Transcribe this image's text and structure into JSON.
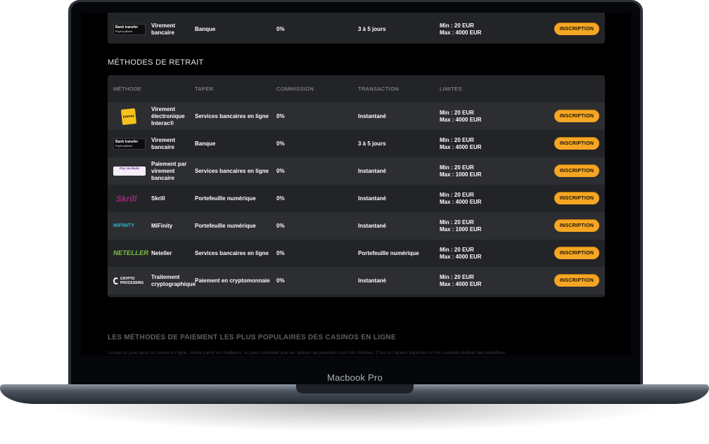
{
  "device": {
    "label": "Macbook Pro"
  },
  "top_row": {
    "logo_text": "Bank transfer",
    "logo_sub": "PayKeyBank",
    "name": "Virement bancaire",
    "type": "Banque",
    "commission": "0%",
    "transaction": "3 à 5 jours",
    "limit_min": "Min : 20 EUR",
    "limit_max": "Max : 4000 EUR",
    "button": "INSCRIPTION"
  },
  "withdrawal": {
    "title": "MÉTHODES DE RETRAIT",
    "headers": {
      "method": "MÉTHODE",
      "type": "TAPER",
      "commission": "COMMISSION",
      "transaction": "TRANSACTION",
      "limits": "LIMITES"
    },
    "rows": [
      {
        "logo": "interac-logo",
        "logo_text": "Interac",
        "name": "Virement électronique Interac®",
        "type": "Services bancaires en ligne",
        "commission": "0%",
        "transaction": "Instantané",
        "limit_min": "Min : 20 EUR",
        "limit_max": "Max : 4000 EUR",
        "button": "INSCRIPTION"
      },
      {
        "logo": "bank-transfer-logo",
        "logo_text": "Bank transfer",
        "logo_sub": "PayKeyBank",
        "name": "Virement bancaire",
        "type": "Banque",
        "commission": "0%",
        "transaction": "3 à 5 jours",
        "limit_min": "Min : 20 EUR",
        "limit_max": "Max : 4000 EUR",
        "button": "INSCRIPTION"
      },
      {
        "logo": "paybybank-logo",
        "logo_text": "Pay via Bank",
        "name": "Paiement par virement bancaire",
        "type": "Services bancaires en ligne",
        "commission": "0%",
        "transaction": "Instantané",
        "limit_min": "Min : 20 EUR",
        "limit_max": "Max : 1000 EUR",
        "button": "INSCRIPTION"
      },
      {
        "logo": "skrill-logo",
        "logo_text": "Skrill",
        "name": "Skrill",
        "type": "Portefeuille numérique",
        "commission": "0%",
        "transaction": "Instantané",
        "limit_min": "Min : 20 EUR",
        "limit_max": "Max : 4000 EUR",
        "button": "INSCRIPTION"
      },
      {
        "logo": "mifinity-logo",
        "logo_text": "MiFINITY",
        "name": "MiFinity",
        "type": "Portefeuille numérique",
        "commission": "0%",
        "transaction": "Instantané",
        "limit_min": "Min : 20 EUR",
        "limit_max": "Max : 1000 EUR",
        "button": "INSCRIPTION"
      },
      {
        "logo": "neteller-logo",
        "logo_text": "NETELLER",
        "name": "Neteller",
        "type": "Services bancaires en ligne",
        "commission": "0%",
        "transaction": "Portefeuille numérique",
        "limit_min": "Min : 20 EUR",
        "limit_max": "Max : 4000 EUR",
        "button": "INSCRIPTION"
      },
      {
        "logo": "crypto-processing-logo",
        "logo_text": "CRYPTO PROCESSING",
        "name": "Traitement cryptographique",
        "type": "Paiement en cryptomonnaie",
        "commission": "0%",
        "transaction": "Instantané",
        "limit_min": "Min : 20 EUR",
        "limit_max": "Max : 4000 EUR",
        "button": "INSCRIPTION"
      }
    ]
  },
  "footer": {
    "title": "LES MÉTHODES DE PAIEMENT LES PLUS POPULAIRES DES CASINOS EN LIGNE",
    "text": "Lorsqu'on joue dans un casino en ligne, même parmi les meilleurs, on peut constater que les options de paiement sont très limitées. C'est un facteur important si l'on souhaite réaliser des bénéfices."
  },
  "colors": {
    "accent": "#f5a623",
    "screen_bg": "#000000",
    "card_bg": "#232427",
    "row_alt_bg": "#2d2e32"
  }
}
